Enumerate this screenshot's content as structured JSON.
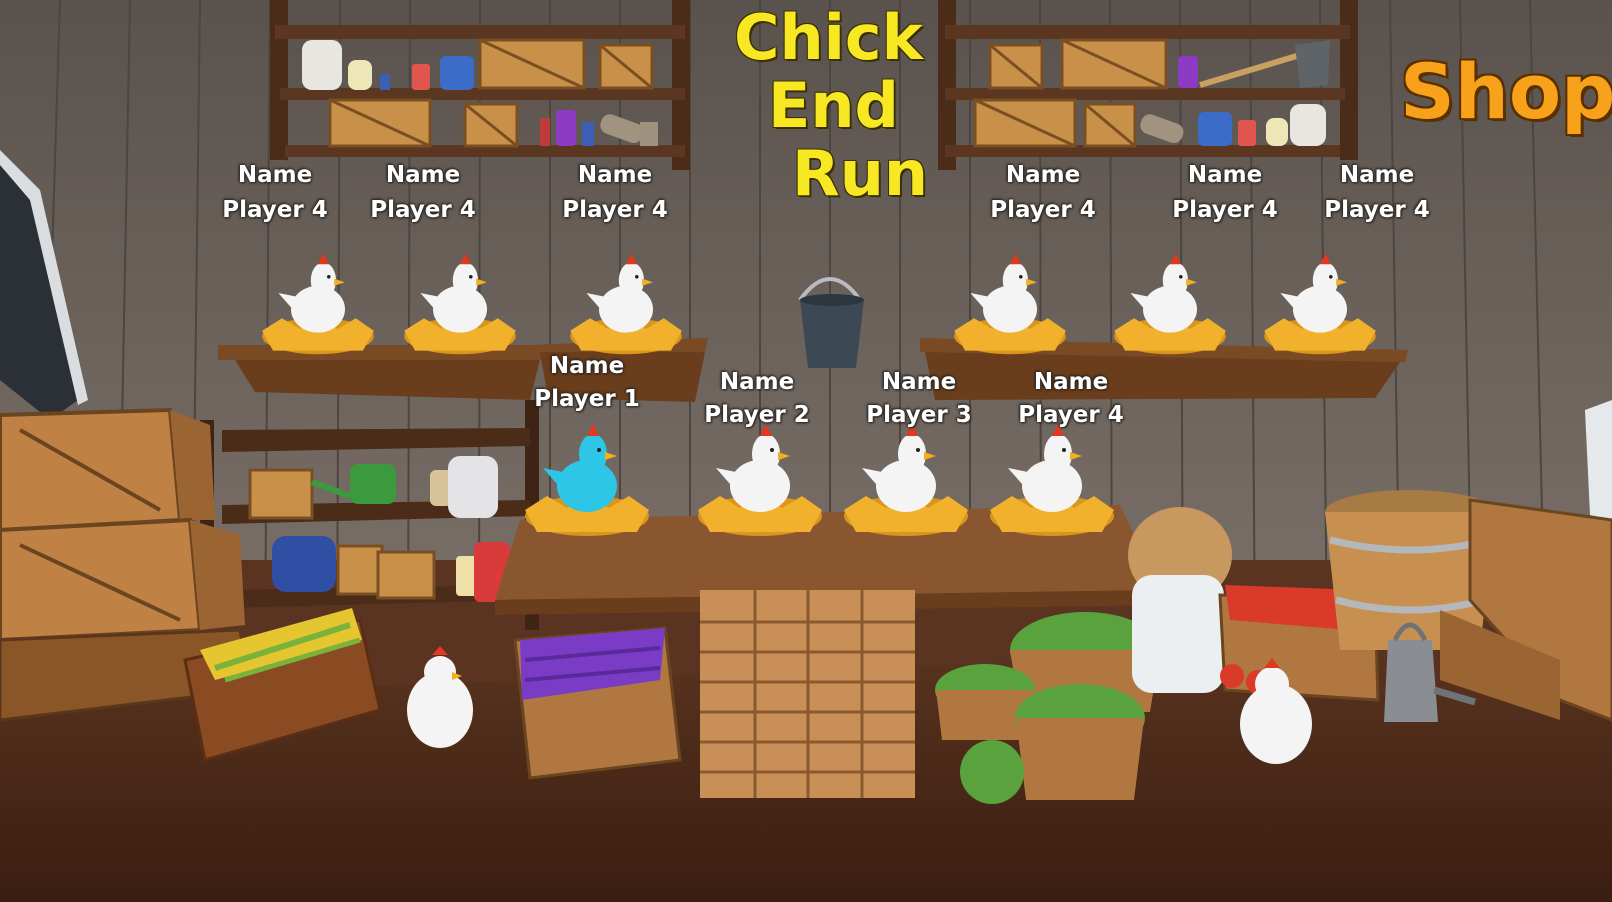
{
  "title": {
    "line1": "Chick",
    "line2": "End",
    "line3": "Run"
  },
  "shop": {
    "label": "Shop"
  },
  "players_main": [
    {
      "name": "Name",
      "player": "Player 1",
      "chicken_color": "#2ec6e6"
    },
    {
      "name": "Name",
      "player": "Player 2",
      "chicken_color": "#f4f4f4"
    },
    {
      "name": "Name",
      "player": "Player 3",
      "chicken_color": "#f4f4f4"
    },
    {
      "name": "Name",
      "player": "Player 4",
      "chicken_color": "#f4f4f4"
    }
  ],
  "players_shelf": [
    {
      "name": "Name",
      "player": "Player 4"
    },
    {
      "name": "Name",
      "player": "Player 4"
    },
    {
      "name": "Name",
      "player": "Player 4"
    },
    {
      "name": "Name",
      "player": "Player 4"
    },
    {
      "name": "Name",
      "player": "Player 4"
    },
    {
      "name": "Name",
      "player": "Player 4"
    }
  ],
  "colors": {
    "title": "#f7e823",
    "shop": "#f7a21a",
    "wall": "#6f6660",
    "floor": "#4a2a1a",
    "wood": "#8a5a2e",
    "straw": "#f2b12c"
  }
}
